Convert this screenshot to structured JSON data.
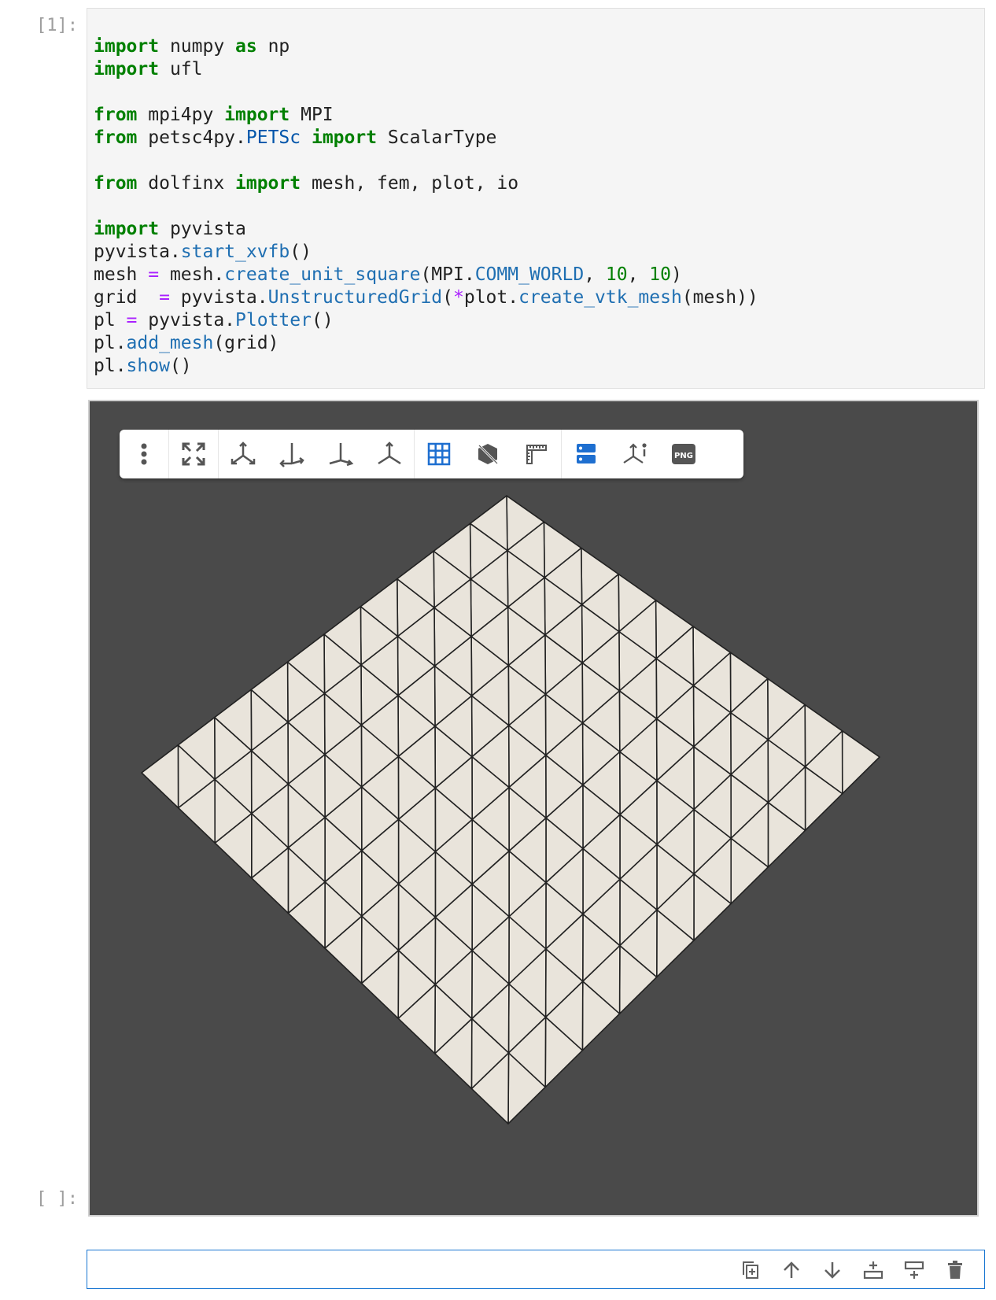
{
  "cells": {
    "cell1_prompt": "[1]:",
    "cell2_prompt": "[ ]:"
  },
  "code_lines": [
    [
      {
        "t": "import",
        "c": "kw"
      },
      {
        "t": " numpy "
      },
      {
        "t": "as",
        "c": "kw"
      },
      {
        "t": " np"
      }
    ],
    [
      {
        "t": "import",
        "c": "kw"
      },
      {
        "t": " ufl"
      }
    ],
    [],
    [
      {
        "t": "from",
        "c": "kw"
      },
      {
        "t": " mpi4py "
      },
      {
        "t": "import",
        "c": "kw"
      },
      {
        "t": " MPI"
      }
    ],
    [
      {
        "t": "from",
        "c": "kw"
      },
      {
        "t": " petsc4py."
      },
      {
        "t": "PETSc",
        "c": "nn"
      },
      {
        "t": " "
      },
      {
        "t": "import",
        "c": "kw"
      },
      {
        "t": " ScalarType"
      }
    ],
    [],
    [
      {
        "t": "from",
        "c": "kw"
      },
      {
        "t": " dolfinx "
      },
      {
        "t": "import",
        "c": "kw"
      },
      {
        "t": " mesh, fem, plot, io"
      }
    ],
    [],
    [
      {
        "t": "import",
        "c": "kw"
      },
      {
        "t": " pyvista"
      }
    ],
    [
      {
        "t": "pyvista."
      },
      {
        "t": "start_xvfb",
        "c": "attr"
      },
      {
        "t": "()"
      }
    ],
    [
      {
        "t": "mesh "
      },
      {
        "t": "=",
        "c": "op"
      },
      {
        "t": " mesh."
      },
      {
        "t": "create_unit_square",
        "c": "attr"
      },
      {
        "t": "(MPI."
      },
      {
        "t": "COMM_WORLD",
        "c": "attr"
      },
      {
        "t": ", "
      },
      {
        "t": "10",
        "c": "num"
      },
      {
        "t": ", "
      },
      {
        "t": "10",
        "c": "num"
      },
      {
        "t": ")"
      }
    ],
    [
      {
        "t": "grid  "
      },
      {
        "t": "=",
        "c": "op"
      },
      {
        "t": " pyvista."
      },
      {
        "t": "UnstructuredGrid",
        "c": "attr"
      },
      {
        "t": "("
      },
      {
        "t": "*",
        "c": "op"
      },
      {
        "t": "plot."
      },
      {
        "t": "create_vtk_mesh",
        "c": "attr"
      },
      {
        "t": "(mesh))"
      }
    ],
    [
      {
        "t": "pl "
      },
      {
        "t": "=",
        "c": "op"
      },
      {
        "t": " pyvista."
      },
      {
        "t": "Plotter",
        "c": "attr"
      },
      {
        "t": "()"
      }
    ],
    [
      {
        "t": "pl."
      },
      {
        "t": "add_mesh",
        "c": "attr"
      },
      {
        "t": "(grid)"
      }
    ],
    [
      {
        "t": "pl."
      },
      {
        "t": "show",
        "c": "attr"
      },
      {
        "t": "()"
      }
    ]
  ],
  "viewer": {
    "background": "#4a4a4a",
    "mesh_color": "#e9e4db",
    "edge_color": "#222222",
    "toolbar": [
      "more-options",
      "fullscreen",
      "view-x",
      "view-y",
      "view-z",
      "view-iso",
      "toggle-grid",
      "toggle-bounds",
      "ruler",
      "toggle-panel",
      "axes-info",
      "screenshot-png"
    ],
    "png_label": "PNG",
    "mesh": {
      "nx": 10,
      "ny": 10
    }
  },
  "cell_toolbar": [
    "duplicate-cell",
    "move-up",
    "move-down",
    "insert-above",
    "insert-below",
    "delete-cell"
  ]
}
